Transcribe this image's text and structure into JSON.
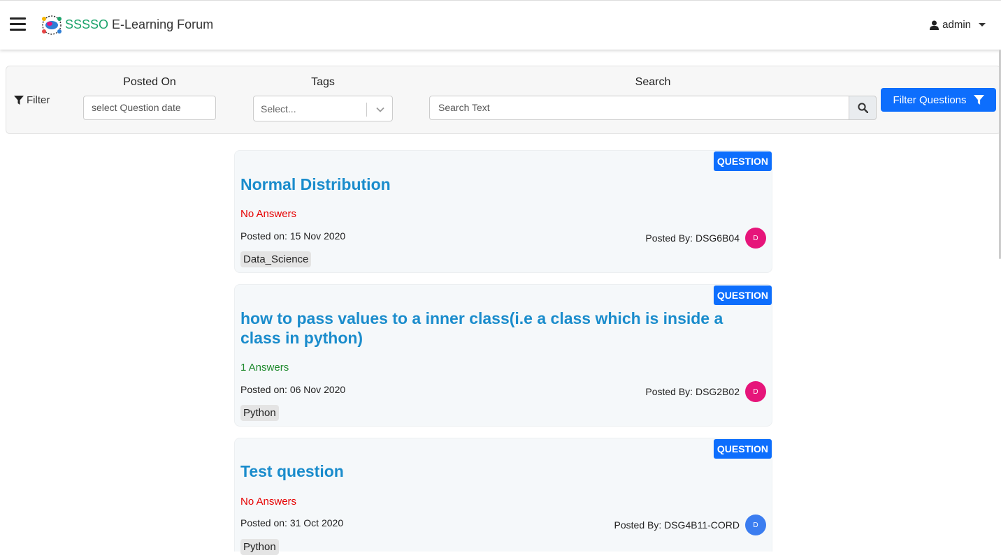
{
  "navbar": {
    "brand_part1": "SSSSO",
    "brand_part2": " E-Learning Forum",
    "user": "admin"
  },
  "filter": {
    "label": "Filter",
    "posted_on_label": "Posted On",
    "date_placeholder": "select Question date",
    "tags_label": "Tags",
    "tags_placeholder": "Select...",
    "search_label": "Search",
    "search_placeholder": "Search Text",
    "button_label": "Filter Questions"
  },
  "questions": [
    {
      "badge": "QUESTION",
      "title": "Normal Distribution",
      "answers": "No Answers",
      "posted_on": "Posted on: 15 Nov 2020",
      "posted_by": "Posted By: DSG6B04",
      "avatar": "D",
      "avatar_color": "#e6157a",
      "tag": "Data_Science"
    },
    {
      "badge": "QUESTION",
      "title": "how to pass values to a inner class(i.e a class which is inside a class in python)",
      "answers": "1 Answers",
      "posted_on": "Posted on: 06 Nov 2020",
      "posted_by": "Posted By: DSG2B02",
      "avatar": "D",
      "avatar_color": "#e6157a",
      "tag": "Python"
    },
    {
      "badge": "QUESTION",
      "title": "Test question",
      "answers": "No Answers",
      "posted_on": "Posted on: 31 Oct 2020",
      "posted_by": "Posted By: DSG4B11-CORD",
      "avatar": "D",
      "avatar_color": "#3b7df0",
      "tag": "Python"
    }
  ],
  "colors": {
    "primary": "#0d6efd",
    "title": "#1a8ccc",
    "no_answers": "#e60000",
    "has_answers": "#1f8a2e",
    "brand_green": "#1aa36a"
  }
}
